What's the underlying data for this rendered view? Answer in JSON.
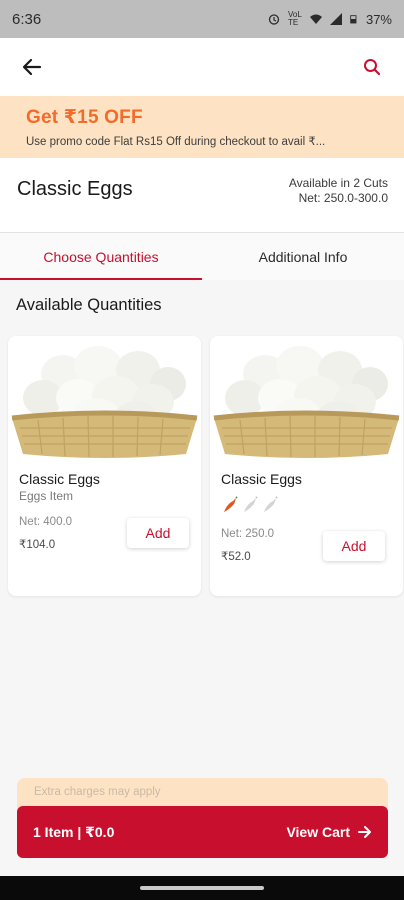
{
  "status": {
    "time": "6:36",
    "battery": "37%",
    "network": "VoLTE"
  },
  "promo": {
    "title": "Get ₹15 OFF",
    "subtitle": "Use promo code Flat Rs15 Off  during checkout to avail ₹..."
  },
  "product": {
    "title": "Classic Eggs",
    "availability": "Available in 2 Cuts",
    "net_range": "Net: 250.0-300.0"
  },
  "tabs": [
    {
      "label": "Choose Quantities",
      "active": true
    },
    {
      "label": "Additional Info",
      "active": false
    }
  ],
  "section_title": "Available Quantities",
  "cards": [
    {
      "name": "Classic Eggs",
      "subtitle": "Eggs Item",
      "net": "Net: 400.0",
      "price": "₹104.0",
      "add_label": "Add",
      "spice_level": 0
    },
    {
      "name": "Classic Eggs",
      "subtitle": "",
      "net": "Net: 250.0",
      "price": "₹52.0",
      "add_label": "Add",
      "spice_level": 1
    }
  ],
  "cart": {
    "note": "Extra charges may apply",
    "summary": "1 Item | ₹0.0",
    "view_cart_label": "View Cart"
  },
  "colors": {
    "accent": "#c8102e",
    "promo_bg": "#fde3c4",
    "promo_text": "#f36b2a"
  }
}
